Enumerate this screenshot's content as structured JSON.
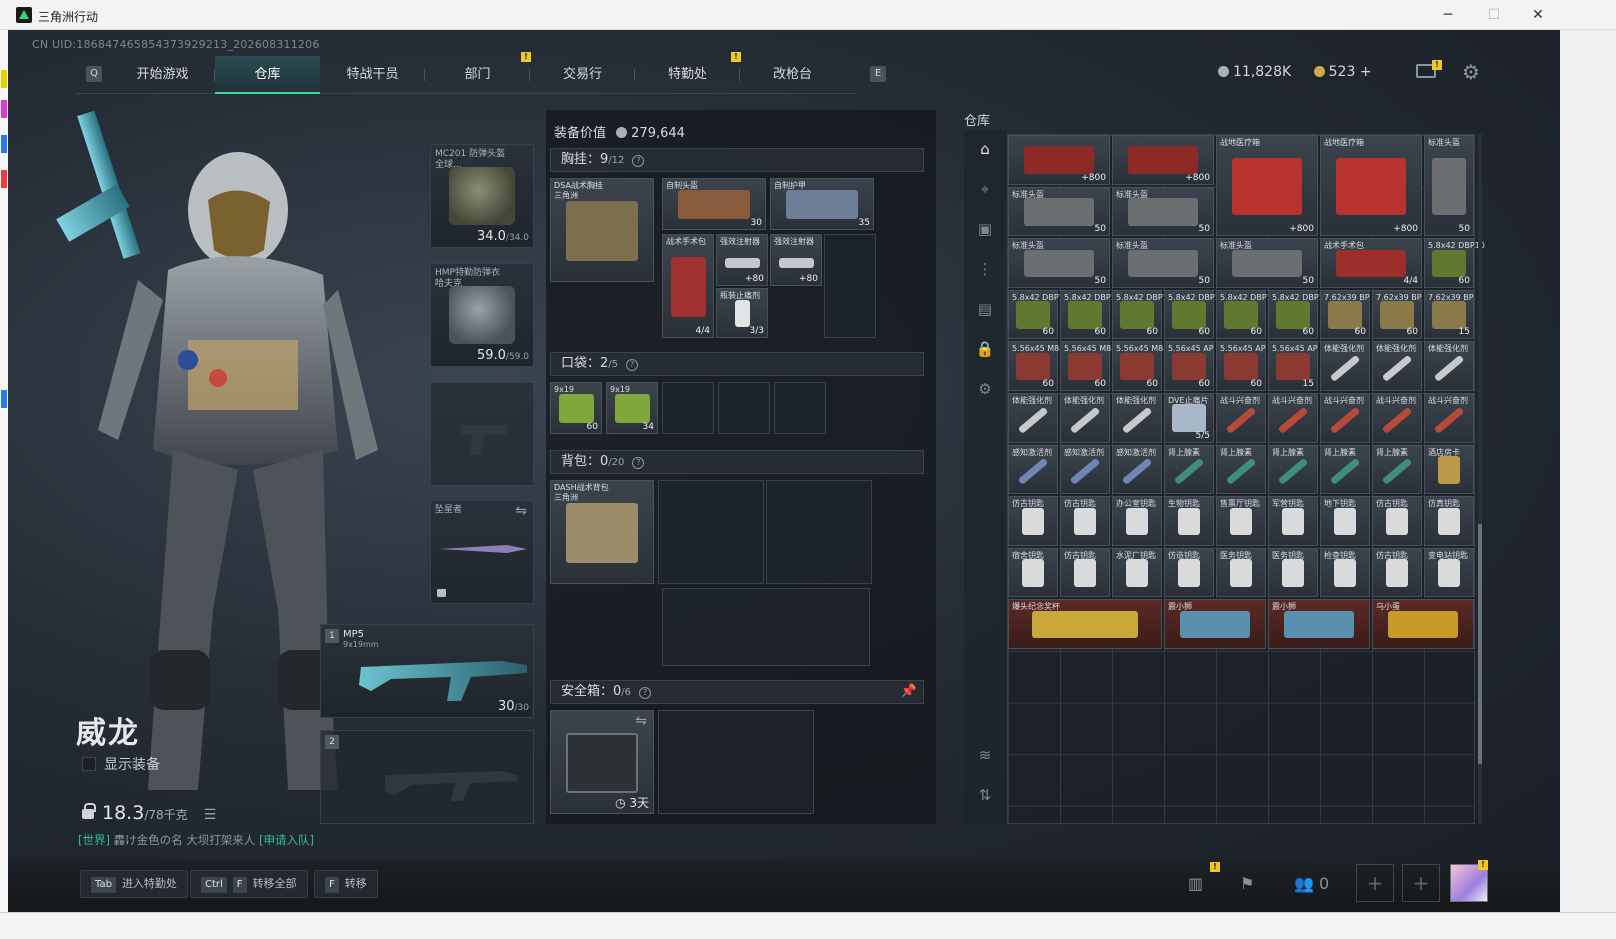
{
  "window": {
    "title": "三角洲行动",
    "minimize_icon": "minimize-icon",
    "maximize_icon": "maximize-icon",
    "close_icon": "close-icon"
  },
  "account": {
    "uid": "CN UID:18684746585437392921​3_202608311206"
  },
  "nav": {
    "left_key": "Q",
    "right_key": "E",
    "tabs": [
      "开始游戏",
      "仓库",
      "特战干员",
      "部门",
      "交易行",
      "特勤处",
      "改枪台"
    ],
    "active_tab": "仓库"
  },
  "currency": {
    "silver": "11,828K",
    "gold": "523",
    "gold_add": "+"
  },
  "character": {
    "name": "威龙",
    "show_gear_label": "显示装备",
    "weight": "18.3",
    "weight_max": "/78千克"
  },
  "chat": {
    "channel": "[世界]",
    "message": "轟け金色の名 大坝打架来人",
    "action": "[申请入队]"
  },
  "gear_slots": {
    "helmet": {
      "name": "MC201 防弹头盔\n全球...",
      "durability": "34.0",
      "durability_max": "/34.0"
    },
    "armor": {
      "name": "HMP特勤防弹衣\n哈夫克",
      "durability": "59.0",
      "durability_max": "/59.0"
    },
    "melee": {
      "name": "坠星者"
    },
    "primary": {
      "slot_no": "1",
      "name": "MP5",
      "caliber": "9x19mm",
      "ammo": "30",
      "ammo_max": "/30"
    },
    "secondary": {
      "slot_no": "2"
    }
  },
  "equipment": {
    "value_label": "装备价值",
    "value": "279,644",
    "rig": {
      "label": "胸挂：",
      "used": "9",
      "cap": "/12",
      "item": "DSA战术胸挂\n三角洲"
    },
    "pocket": {
      "label": "口袋：",
      "used": "2",
      "cap": "/5"
    },
    "backpack": {
      "label": "背包：",
      "used": "0",
      "cap": "/20",
      "item": "DASH战术背包\n三角洲"
    },
    "safebox": {
      "label": "安全箱：",
      "used": "0",
      "cap": "/6",
      "timer": "3天"
    }
  },
  "rig_items": [
    {
      "name": "自制头盔",
      "qty": "30"
    },
    {
      "name": "自制护甲",
      "qty": "35"
    },
    {
      "name": "战术手术包",
      "qty": "4/4"
    },
    {
      "name": "强效注射器",
      "qty": "+80"
    },
    {
      "name": "强效注射器",
      "qty": "+80"
    },
    {
      "name": "瓶装止痛剂",
      "qty": "3/3"
    }
  ],
  "pocket_items": [
    {
      "name": "9x19",
      "qty": "60"
    },
    {
      "name": "9x19",
      "qty": "34"
    }
  ],
  "warehouse": {
    "title": "仓库",
    "items": [
      {
        "name": "",
        "qty": "+800"
      },
      {
        "name": "",
        "qty": "+800"
      },
      {
        "name": "战地医疗箱",
        "qty": "+800"
      },
      {
        "name": "战地医疗箱",
        "qty": "+800"
      },
      {
        "name": "标准头盔",
        "qty": "50"
      },
      {
        "name": "标准头盔",
        "qty": "50"
      },
      {
        "name": "标准头盔",
        "qty": "50"
      },
      {
        "name": "标准头盔",
        "qty": "50"
      },
      {
        "name": "标准头盔",
        "qty": "50"
      },
      {
        "name": "标准头盔",
        "qty": "50"
      },
      {
        "name": "战术手术包",
        "qty": "4/4"
      },
      {
        "name": "5.8x42 DBP10",
        "qty": "60"
      },
      {
        "name": "5.8x42 DBP10",
        "qty": "60"
      },
      {
        "name": "5.8x42 DBP10",
        "qty": "60"
      },
      {
        "name": "5.8x42 DBP10",
        "qty": "60"
      },
      {
        "name": "5.8x42 DBP10",
        "qty": "60"
      },
      {
        "name": "5.8x42 DBP10",
        "qty": "60"
      },
      {
        "name": "5.8x42 DBP10",
        "qty": "60"
      },
      {
        "name": "7.62x39 BP",
        "qty": "60"
      },
      {
        "name": "7.62x39 BP",
        "qty": "60"
      },
      {
        "name": "7.62x39 BP",
        "qty": "15"
      },
      {
        "name": "5.56x45 M855",
        "qty": "60"
      },
      {
        "name": "5.56x45 M855",
        "qty": "60"
      },
      {
        "name": "5.56x45 M855",
        "qty": "60"
      },
      {
        "name": "5.56x45 AP",
        "qty": "60"
      },
      {
        "name": "5.56x45 AP",
        "qty": "60"
      },
      {
        "name": "5.56x45 AP",
        "qty": "15"
      },
      {
        "name": "体能强化剂",
        "qty": ""
      },
      {
        "name": "体能强化剂",
        "qty": ""
      },
      {
        "name": "体能强化剂",
        "qty": ""
      },
      {
        "name": "体能强化剂",
        "qty": ""
      },
      {
        "name": "体能强化剂",
        "qty": ""
      },
      {
        "name": "体能强化剂",
        "qty": ""
      },
      {
        "name": "DVE止痛片",
        "qty": "5/5"
      },
      {
        "name": "战斗兴奋剂",
        "qty": ""
      },
      {
        "name": "战斗兴奋剂",
        "qty": ""
      },
      {
        "name": "战斗兴奋剂",
        "qty": ""
      },
      {
        "name": "战斗兴奋剂",
        "qty": ""
      },
      {
        "name": "战斗兴奋剂",
        "qty": ""
      },
      {
        "name": "感知激活剂",
        "qty": ""
      },
      {
        "name": "感知激活剂",
        "qty": ""
      },
      {
        "name": "感知激活剂",
        "qty": ""
      },
      {
        "name": "肾上腺素",
        "qty": ""
      },
      {
        "name": "肾上腺素",
        "qty": ""
      },
      {
        "name": "肾上腺素",
        "qty": ""
      },
      {
        "name": "肾上腺素",
        "qty": ""
      },
      {
        "name": "肾上腺素",
        "qty": ""
      },
      {
        "name": "酒店房卡",
        "qty": ""
      },
      {
        "name": "仿古钥匙",
        "qty": ""
      },
      {
        "name": "仿古钥匙",
        "qty": ""
      },
      {
        "name": "办公室钥匙",
        "qty": ""
      },
      {
        "name": "生物钥匙",
        "qty": ""
      },
      {
        "name": "售票厅钥匙",
        "qty": ""
      },
      {
        "name": "军营钥匙",
        "qty": ""
      },
      {
        "name": "地下钥匙",
        "qty": ""
      },
      {
        "name": "仿古钥匙",
        "qty": ""
      },
      {
        "name": "仿真钥匙",
        "qty": ""
      },
      {
        "name": "宿舍钥匙",
        "qty": ""
      },
      {
        "name": "仿古钥匙",
        "qty": ""
      },
      {
        "name": "水泥厂钥匙",
        "qty": ""
      },
      {
        "name": "仿造钥匙",
        "qty": ""
      },
      {
        "name": "医务钥匙",
        "qty": ""
      },
      {
        "name": "医务钥匙",
        "qty": ""
      },
      {
        "name": "检查钥匙",
        "qty": ""
      },
      {
        "name": "仿古钥匙",
        "qty": ""
      },
      {
        "name": "变电站钥匙",
        "qty": ""
      },
      {
        "name": "爆头纪念奖杯",
        "qty": ""
      },
      {
        "name": "震小狮",
        "qty": ""
      },
      {
        "name": "震小狮",
        "qty": ""
      },
      {
        "name": "乌小蛋",
        "qty": ""
      }
    ]
  },
  "bottom": {
    "hints": [
      {
        "keys": [
          "Tab"
        ],
        "label": "进入特勤处"
      },
      {
        "keys": [
          "Ctrl",
          "F"
        ],
        "label": "转移全部"
      },
      {
        "keys": [
          "F"
        ],
        "label": "转移"
      }
    ],
    "squad_count": "0"
  }
}
